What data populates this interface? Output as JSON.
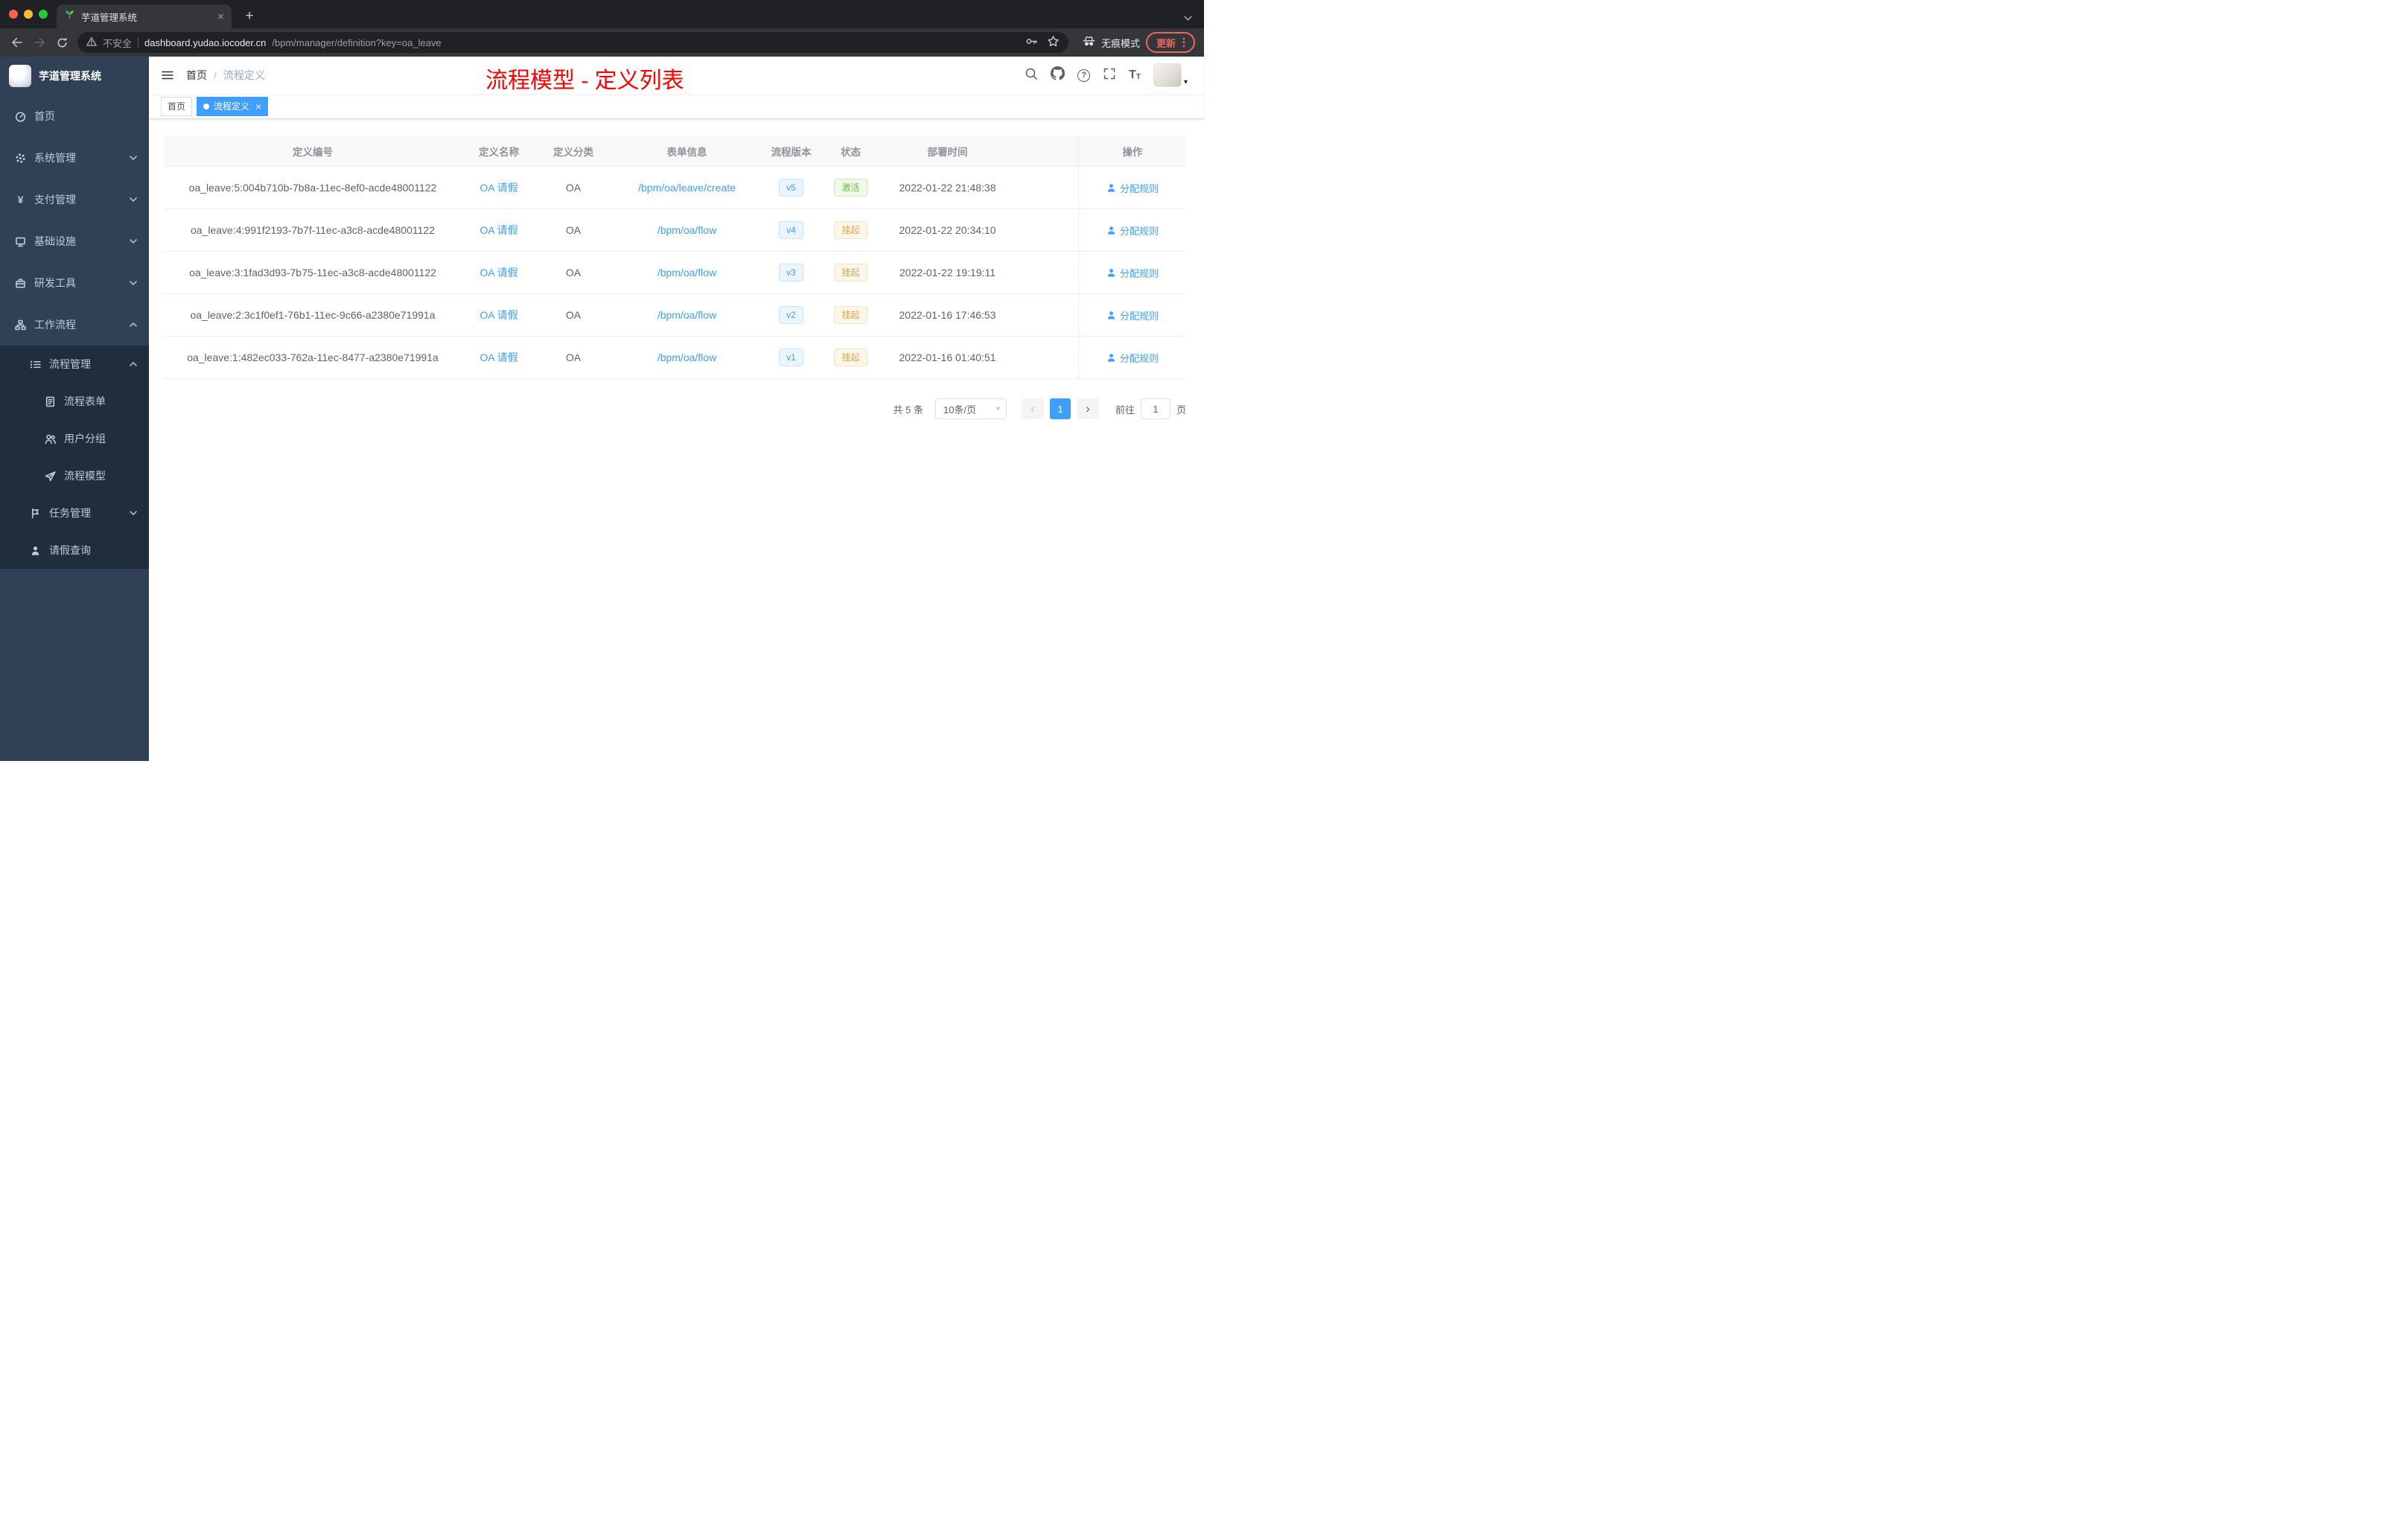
{
  "colors": {
    "accent": "#409eff",
    "annotation_red": "#fe0000",
    "status_active_green": "#67c23a",
    "status_suspend_orange": "#e6a23c",
    "sidebar_bg": "#304156",
    "sidebar_submenu_bg": "#1f2d3d"
  },
  "glyphs": {
    "close": "×",
    "plus": "+",
    "question": "?",
    "prev": "‹",
    "next": "›",
    "caret_down": "▾",
    "yen": "¥",
    "fontsize_big": "T",
    "fontsize_small": "T"
  },
  "browser": {
    "tab_title": "芋道管理系统",
    "security_label": "不安全",
    "url_domain": "dashboard.yudao.iocoder.cn",
    "url_path": "/bpm/manager/definition?key=oa_leave",
    "incognito_label": "无痕模式",
    "update_label": "更新"
  },
  "sidebar": {
    "brand": "芋道管理系统",
    "menu": [
      {
        "label": "首页"
      },
      {
        "label": "系统管理"
      },
      {
        "label": "支付管理"
      },
      {
        "label": "基础设施"
      },
      {
        "label": "研发工具"
      },
      {
        "label": "工作流程"
      }
    ],
    "submenu": [
      {
        "label": "流程管理"
      },
      {
        "label": "流程表单"
      },
      {
        "label": "用户分组"
      },
      {
        "label": "流程模型"
      },
      {
        "label": "任务管理"
      },
      {
        "label": "请假查询"
      }
    ]
  },
  "navbar": {
    "breadcrumb_home": "首页",
    "breadcrumb_sep": "/",
    "breadcrumb_current": "流程定义",
    "annotation": "流程模型 - 定义列表"
  },
  "tags": {
    "home": "首页",
    "current": "流程定义"
  },
  "table": {
    "columns": [
      "定义编号",
      "定义名称",
      "定义分类",
      "表单信息",
      "流程版本",
      "状态",
      "部署时间",
      "操作"
    ],
    "action_label": "分配规则",
    "rows": [
      {
        "id": "oa_leave:5:004b710b-7b8a-11ec-8ef0-acde48001122",
        "name": "OA 请假",
        "category": "OA",
        "form": "/bpm/oa/leave/create",
        "version": "v5",
        "status": "激活",
        "time": "2022-01-22 21:48:38"
      },
      {
        "id": "oa_leave:4:991f2193-7b7f-11ec-a3c8-acde48001122",
        "name": "OA 请假",
        "category": "OA",
        "form": "/bpm/oa/flow",
        "version": "v4",
        "status": "挂起",
        "time": "2022-01-22 20:34:10"
      },
      {
        "id": "oa_leave:3:1fad3d93-7b75-11ec-a3c8-acde48001122",
        "name": "OA 请假",
        "category": "OA",
        "form": "/bpm/oa/flow",
        "version": "v3",
        "status": "挂起",
        "time": "2022-01-22 19:19:11"
      },
      {
        "id": "oa_leave:2:3c1f0ef1-76b1-11ec-9c66-a2380e71991a",
        "name": "OA 请假",
        "category": "OA",
        "form": "/bpm/oa/flow",
        "version": "v2",
        "status": "挂起",
        "time": "2022-01-16 17:46:53"
      },
      {
        "id": "oa_leave:1:482ec033-762a-11ec-8477-a2380e71991a",
        "name": "OA 请假",
        "category": "OA",
        "form": "/bpm/oa/flow",
        "version": "v1",
        "status": "挂起",
        "time": "2022-01-16 01:40:51"
      }
    ]
  },
  "pagination": {
    "total": "共 5 条",
    "page_size": "10条/页",
    "page": "1",
    "goto_label": "前往",
    "page_unit": "页",
    "goto_value": "1"
  }
}
